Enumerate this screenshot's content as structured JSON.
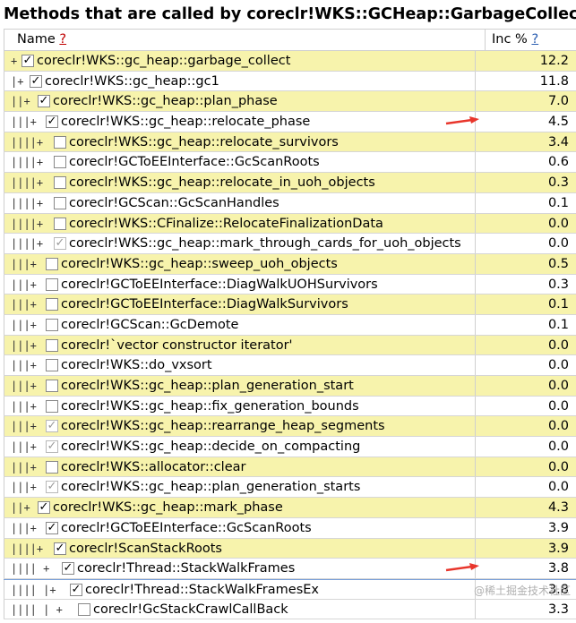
{
  "title": "Methods that are called by coreclr!WKS::GCHeap::GarbageCollectGeneration",
  "header": {
    "name_label": "Name",
    "name_help": "?",
    "inc_label": "Inc %",
    "inc_help": "?"
  },
  "rows": [
    {
      "tree": "+",
      "check": "checked",
      "name": "coreclr!WKS::gc_heap::garbage_collect",
      "inc": "12.2",
      "hl": true,
      "depth": 0
    },
    {
      "tree": "|+",
      "check": "checked",
      "name": "coreclr!WKS::gc_heap::gc1",
      "inc": "11.8",
      "hl": false,
      "depth": 1
    },
    {
      "tree": "||+",
      "check": "checked",
      "name": "coreclr!WKS::gc_heap::plan_phase",
      "inc": "7.0",
      "hl": true,
      "depth": 2
    },
    {
      "tree": "|||+",
      "check": "checked",
      "name": "coreclr!WKS::gc_heap::relocate_phase",
      "inc": "4.5",
      "hl": false,
      "depth": 3,
      "arrow": true
    },
    {
      "tree": "||||+",
      "check": "empty",
      "name": "coreclr!WKS::gc_heap::relocate_survivors",
      "inc": "3.4",
      "hl": true,
      "depth": 4
    },
    {
      "tree": "||||+",
      "check": "empty",
      "name": "coreclr!GCToEEInterface::GcScanRoots",
      "inc": "0.6",
      "hl": false,
      "depth": 4
    },
    {
      "tree": "||||+",
      "check": "empty",
      "name": "coreclr!WKS::gc_heap::relocate_in_uoh_objects",
      "inc": "0.3",
      "hl": true,
      "depth": 4
    },
    {
      "tree": "||||+",
      "check": "empty",
      "name": "coreclr!GCScan::GcScanHandles",
      "inc": "0.1",
      "hl": false,
      "depth": 4
    },
    {
      "tree": "||||+",
      "check": "empty",
      "name": "coreclr!WKS::CFinalize::RelocateFinalizationData",
      "inc": "0.0",
      "hl": true,
      "depth": 4
    },
    {
      "tree": "||||+",
      "check": "gray",
      "name": "coreclr!WKS::gc_heap::mark_through_cards_for_uoh_objects",
      "inc": "0.0",
      "hl": false,
      "depth": 4
    },
    {
      "tree": "|||+",
      "check": "empty",
      "name": "coreclr!WKS::gc_heap::sweep_uoh_objects",
      "inc": "0.5",
      "hl": true,
      "depth": 3
    },
    {
      "tree": "|||+",
      "check": "empty",
      "name": "coreclr!GCToEEInterface::DiagWalkUOHSurvivors",
      "inc": "0.3",
      "hl": false,
      "depth": 3
    },
    {
      "tree": "|||+",
      "check": "empty",
      "name": "coreclr!GCToEEInterface::DiagWalkSurvivors",
      "inc": "0.1",
      "hl": true,
      "depth": 3
    },
    {
      "tree": "|||+",
      "check": "empty",
      "name": "coreclr!GCScan::GcDemote",
      "inc": "0.1",
      "hl": false,
      "depth": 3
    },
    {
      "tree": "|||+",
      "check": "empty",
      "name": "coreclr!`vector constructor iterator'",
      "inc": "0.0",
      "hl": true,
      "depth": 3
    },
    {
      "tree": "|||+",
      "check": "empty",
      "name": "coreclr!WKS::do_vxsort",
      "inc": "0.0",
      "hl": false,
      "depth": 3
    },
    {
      "tree": "|||+",
      "check": "empty",
      "name": "coreclr!WKS::gc_heap::plan_generation_start",
      "inc": "0.0",
      "hl": true,
      "depth": 3
    },
    {
      "tree": "|||+",
      "check": "empty",
      "name": "coreclr!WKS::gc_heap::fix_generation_bounds",
      "inc": "0.0",
      "hl": false,
      "depth": 3
    },
    {
      "tree": "|||+",
      "check": "gray",
      "name": "coreclr!WKS::gc_heap::rearrange_heap_segments",
      "inc": "0.0",
      "hl": true,
      "depth": 3
    },
    {
      "tree": "|||+",
      "check": "gray",
      "name": "coreclr!WKS::gc_heap::decide_on_compacting",
      "inc": "0.0",
      "hl": false,
      "depth": 3
    },
    {
      "tree": "|||+",
      "check": "empty",
      "name": "coreclr!WKS::allocator::clear",
      "inc": "0.0",
      "hl": true,
      "depth": 3
    },
    {
      "tree": "|||+",
      "check": "gray",
      "name": "coreclr!WKS::gc_heap::plan_generation_starts",
      "inc": "0.0",
      "hl": false,
      "depth": 3
    },
    {
      "tree": "||+",
      "check": "checked",
      "name": "coreclr!WKS::gc_heap::mark_phase",
      "inc": "4.3",
      "hl": true,
      "depth": 2
    },
    {
      "tree": "|||+",
      "check": "checked",
      "name": "coreclr!GCToEEInterface::GcScanRoots",
      "inc": "3.9",
      "hl": false,
      "depth": 3
    },
    {
      "tree": "||||+",
      "check": "checked",
      "name": "coreclr!ScanStackRoots",
      "inc": "3.9",
      "hl": true,
      "depth": 4
    },
    {
      "tree": "|||| +",
      "check": "checked",
      "name": "coreclr!Thread::StackWalkFrames",
      "inc": "3.8",
      "hl": false,
      "depth": 5,
      "arrow": true
    },
    {
      "tree": "|||| |+",
      "check": "checked",
      "name": "coreclr!Thread::StackWalkFramesEx",
      "inc": "3.8",
      "hl": false,
      "depth": 6,
      "selected": true
    },
    {
      "tree": "|||| | +",
      "check": "empty",
      "name": "coreclr!GcStackCrawlCallBack",
      "inc": "3.3",
      "hl": false,
      "depth": 7
    }
  ],
  "watermark": "@稀土掘金技术社区",
  "colors": {
    "highlight": "#f7f3ac",
    "arrow": "#e8352b",
    "help_red": "#c00000",
    "help_blue": "#2a5db0"
  }
}
